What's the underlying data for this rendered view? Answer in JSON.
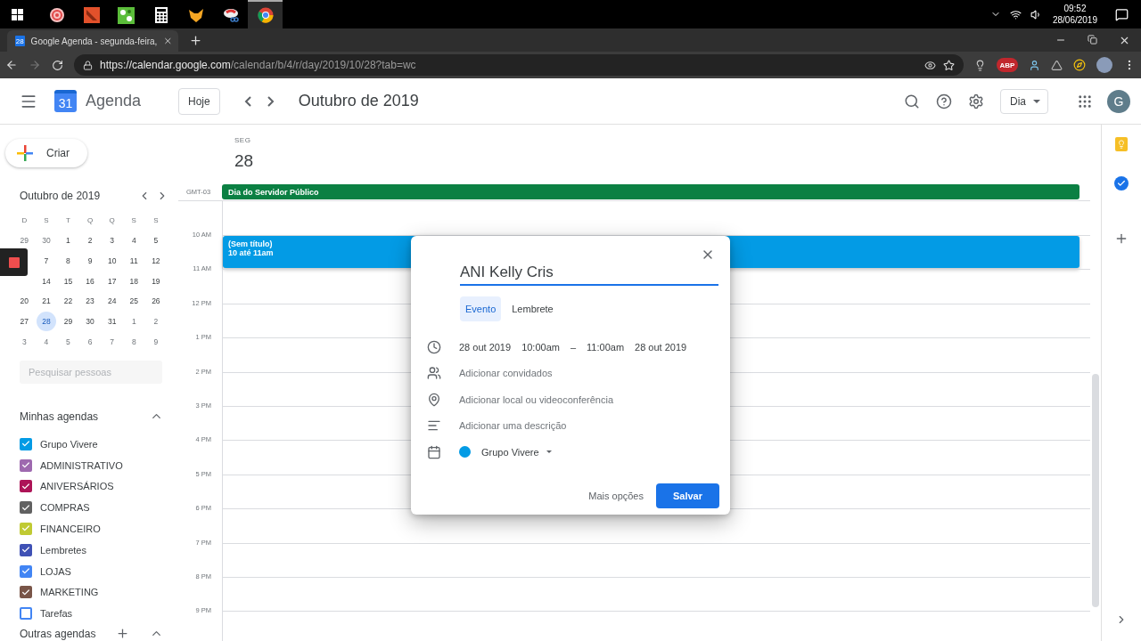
{
  "taskbar": {
    "apps": [
      {
        "kind": "spiral",
        "selected": false
      },
      {
        "kind": "slash",
        "selected": false
      },
      {
        "kind": "puzzle",
        "selected": false
      },
      {
        "kind": "calculator",
        "selected": false
      },
      {
        "kind": "fox",
        "selected": false
      },
      {
        "kind": "scissors",
        "selected": false
      },
      {
        "kind": "chrome",
        "selected": true
      }
    ],
    "time": "09:52",
    "date": "28/06/2019"
  },
  "browser": {
    "tab": {
      "favicon": "28",
      "title": "Google Agenda - segunda-feira,"
    },
    "url_host": "https://calendar.google.com",
    "url_path": "/calendar/b/4/r/day/2019/10/28?tab=wc",
    "extension_label": "ABP"
  },
  "app_header": {
    "logo_day": "31",
    "product": "Agenda",
    "today_button": "Hoje",
    "period": "Outubro de 2019",
    "view": "Dia",
    "avatar": "G"
  },
  "sidebar": {
    "create_button": "Criar",
    "mini_calendar": {
      "title": "Outubro de 2019",
      "weekdays": [
        "D",
        "S",
        "T",
        "Q",
        "Q",
        "S",
        "S"
      ],
      "weeks": [
        [
          {
            "kind": "day",
            "label": "29",
            "muted": true,
            "selected": false
          },
          {
            "kind": "day",
            "label": "30",
            "muted": true,
            "selected": false
          },
          {
            "kind": "day",
            "label": "1",
            "muted": false,
            "selected": false
          },
          {
            "kind": "day",
            "label": "2",
            "muted": false,
            "selected": false
          },
          {
            "kind": "day",
            "label": "3",
            "muted": false,
            "selected": false
          },
          {
            "kind": "day",
            "label": "4",
            "muted": false,
            "selected": false
          },
          {
            "kind": "day",
            "label": "5",
            "muted": false,
            "selected": false
          }
        ],
        [
          {
            "kind": "covered"
          },
          {
            "kind": "day",
            "label": "7",
            "muted": false,
            "selected": false
          },
          {
            "kind": "day",
            "label": "8",
            "muted": false,
            "selected": false
          },
          {
            "kind": "day",
            "label": "9",
            "muted": false,
            "selected": false
          },
          {
            "kind": "day",
            "label": "10",
            "muted": false,
            "selected": false
          },
          {
            "kind": "day",
            "label": "11",
            "muted": false,
            "selected": false
          },
          {
            "kind": "day",
            "label": "12",
            "muted": false,
            "selected": false
          }
        ],
        [
          {
            "kind": "covered"
          },
          {
            "kind": "day",
            "label": "14",
            "muted": false,
            "selected": false
          },
          {
            "kind": "day",
            "label": "15",
            "muted": false,
            "selected": false
          },
          {
            "kind": "day",
            "label": "16",
            "muted": false,
            "selected": false
          },
          {
            "kind": "day",
            "label": "17",
            "muted": false,
            "selected": false
          },
          {
            "kind": "day",
            "label": "18",
            "muted": false,
            "selected": false
          },
          {
            "kind": "day",
            "label": "19",
            "muted": false,
            "selected": false
          }
        ],
        [
          {
            "kind": "day",
            "label": "20",
            "muted": false,
            "selected": false
          },
          {
            "kind": "day",
            "label": "21",
            "muted": false,
            "selected": false
          },
          {
            "kind": "day",
            "label": "22",
            "muted": false,
            "selected": false
          },
          {
            "kind": "day",
            "label": "23",
            "muted": false,
            "selected": false
          },
          {
            "kind": "day",
            "label": "24",
            "muted": false,
            "selected": false
          },
          {
            "kind": "day",
            "label": "25",
            "muted": false,
            "selected": false
          },
          {
            "kind": "day",
            "label": "26",
            "muted": false,
            "selected": false
          }
        ],
        [
          {
            "kind": "day",
            "label": "27",
            "muted": false,
            "selected": false
          },
          {
            "kind": "day",
            "label": "28",
            "muted": false,
            "selected": true
          },
          {
            "kind": "day",
            "label": "29",
            "muted": false,
            "selected": false
          },
          {
            "kind": "day",
            "label": "30",
            "muted": false,
            "selected": false
          },
          {
            "kind": "day",
            "label": "31",
            "muted": false,
            "selected": false
          },
          {
            "kind": "day",
            "label": "1",
            "muted": true,
            "selected": false
          },
          {
            "kind": "day",
            "label": "2",
            "muted": true,
            "selected": false
          }
        ],
        [
          {
            "kind": "day",
            "label": "3",
            "muted": true,
            "selected": false
          },
          {
            "kind": "day",
            "label": "4",
            "muted": true,
            "selected": false
          },
          {
            "kind": "day",
            "label": "5",
            "muted": true,
            "selected": false
          },
          {
            "kind": "day",
            "label": "6",
            "muted": true,
            "selected": false
          },
          {
            "kind": "day",
            "label": "7",
            "muted": true,
            "selected": false
          },
          {
            "kind": "day",
            "label": "8",
            "muted": true,
            "selected": false
          },
          {
            "kind": "day",
            "label": "9",
            "muted": true,
            "selected": false
          }
        ]
      ]
    },
    "people_search": {
      "placeholder": "Pesquisar pessoas"
    },
    "my_calendars": {
      "title": "Minhas agendas",
      "expanded": true,
      "items": [
        {
          "label": "Grupo Vivere",
          "checked": true,
          "color": "#039be5"
        },
        {
          "label": "ADMINISTRATIVO",
          "checked": true,
          "color": "#9e69af"
        },
        {
          "label": "ANIVERSÁRIOS",
          "checked": true,
          "color": "#ad1457"
        },
        {
          "label": "COMPRAS",
          "checked": true,
          "color": "#616161"
        },
        {
          "label": "FINANCEIRO",
          "checked": true,
          "color": "#c0ca33"
        },
        {
          "label": "Lembretes",
          "checked": true,
          "color": "#3f51b5"
        },
        {
          "label": "LOJAS",
          "checked": true,
          "color": "#4285f4"
        },
        {
          "label": "MARKETING",
          "checked": true,
          "color": "#795548"
        },
        {
          "label": "Tarefas",
          "checked": false,
          "color": "#4285f4"
        }
      ]
    },
    "other_calendars": {
      "title": "Outras agendas",
      "expanded": true
    }
  },
  "day_view": {
    "weekday": "SEG",
    "date": "28",
    "timezone": "GMT-03",
    "all_day_events": [
      {
        "title": "Dia do Servidor Público",
        "color": "#0b8043"
      }
    ],
    "hours": [
      "10 AM",
      "11 AM",
      "12 PM",
      "1 PM",
      "2 PM",
      "3 PM",
      "4 PM",
      "5 PM",
      "6 PM",
      "7 PM",
      "8 PM",
      "9 PM"
    ],
    "events": [
      {
        "title": "(Sem título)",
        "time": "10 até 11am",
        "color": "#039be5"
      }
    ]
  },
  "event_dialog": {
    "title_value": "ANI Kelly Cris",
    "tabs": [
      {
        "label": "Evento",
        "selected": true
      },
      {
        "label": "Lembrete",
        "selected": false
      }
    ],
    "start_date": "28 out 2019",
    "start_time": "10:00am",
    "separator": "–",
    "end_time": "11:00am",
    "end_date": "28 out 2019",
    "guests": {
      "placeholder": "Adicionar convidados"
    },
    "location": {
      "placeholder": "Adicionar local ou videoconferência"
    },
    "description": {
      "placeholder": "Adicionar uma descrição"
    },
    "calendar": {
      "name": "Grupo Vivere",
      "color": "#039be5"
    },
    "more_button": "Mais opções",
    "save_button": "Salvar"
  }
}
